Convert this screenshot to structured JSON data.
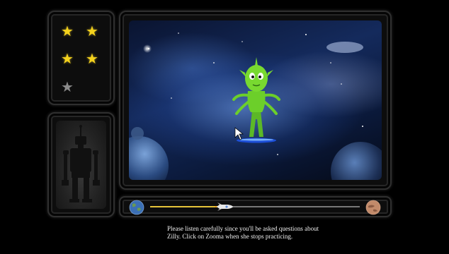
{
  "progress": {
    "fraction": 0.33
  },
  "stars": {
    "earned": 4,
    "total": 5
  },
  "character": {
    "name": "Zilly"
  },
  "instructions": {
    "line1": "Please listen carefully since you'll be asked questions about",
    "line2": "Zilly. Click on Zooma when she stops practicing."
  },
  "colors": {
    "star_gold": "#f4d21c",
    "star_grey": "#8a8a8a",
    "progress_fill": "#e6c43a",
    "alien_green": "#6ccf2a"
  },
  "icons": {
    "star": "star-icon",
    "robot": "robot-icon",
    "earth": "earth-icon",
    "mars": "mars-icon",
    "rocket": "rocket-icon"
  }
}
